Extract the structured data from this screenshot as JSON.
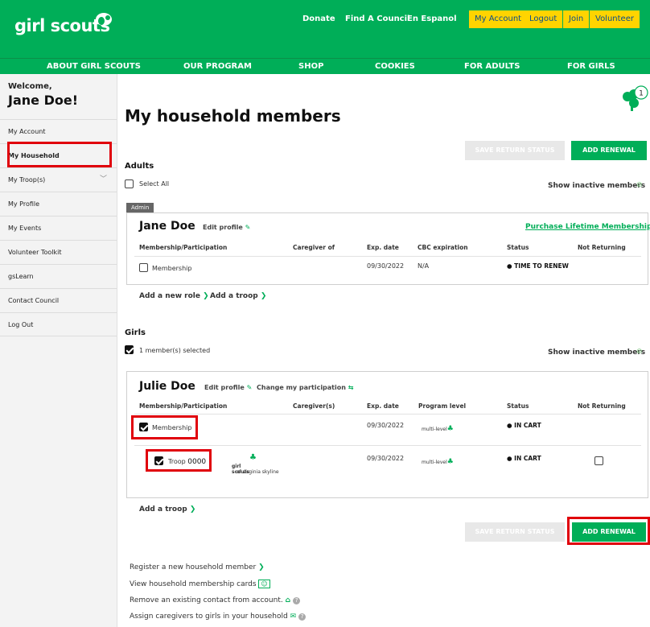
{
  "header": {
    "logo_text": "girl scouts",
    "top_links": [
      "Donate",
      "Find A Council",
      "En Espanol"
    ],
    "account_buttons": [
      "My Account",
      "Logout",
      "Join",
      "Volunteer"
    ],
    "nav": [
      "ABOUT GIRL SCOUTS",
      "OUR PROGRAM",
      "SHOP",
      "COOKIES",
      "FOR ADULTS",
      "FOR GIRLS"
    ],
    "cart_count": "1"
  },
  "sidebar": {
    "welcome": "Welcome,",
    "name": "Jane Doe!",
    "items": [
      {
        "label": "My Account"
      },
      {
        "label": "My Household"
      },
      {
        "label": "My Troop(s)"
      },
      {
        "label": "My Profile"
      },
      {
        "label": "My Events"
      },
      {
        "label": "Volunteer Toolkit"
      },
      {
        "label": "gsLearn"
      },
      {
        "label": "Contact Council"
      },
      {
        "label": "Log Out"
      }
    ]
  },
  "main": {
    "title": "My household members",
    "save_return_status": "SAVE RETURN STATUS",
    "add_renewal": "ADD RENEWAL",
    "adults": {
      "heading": "Adults",
      "select_all": "Select All",
      "show_inactive": "Show inactive members",
      "admin_tag": "Admin",
      "member_name": "Jane Doe",
      "edit_profile": "Edit profile",
      "lifetime": "Purchase Lifetime Membership",
      "columns": [
        "Membership/Participation",
        "Caregiver of",
        "Exp. date",
        "CBC expiration",
        "Status",
        "Not Returning"
      ],
      "row": {
        "label": "Membership",
        "exp": "09/30/2022",
        "cbc": "N/A",
        "status": "TIME TO RENEW"
      },
      "add_role": "Add a new role",
      "add_troop": "Add a troop"
    },
    "girls": {
      "heading": "Girls",
      "selected": "1 member(s) selected",
      "show_inactive": "Show inactive members",
      "member_name": "Julie Doe",
      "edit_profile": "Edit profile",
      "change_participation": "Change my participation",
      "columns": [
        "Membership/Participation",
        "Caregiver(s)",
        "Exp. date",
        "Program level",
        "Status",
        "Not Returning"
      ],
      "rows": [
        {
          "label": "Membership",
          "exp": "09/30/2022",
          "level": "multi-level",
          "status": "IN CART"
        },
        {
          "label": "Troop",
          "troop_no": "0000",
          "council_line1": "girl scouts",
          "council_line2": "of virginia skyline",
          "exp": "09/30/2022",
          "level": "multi-level",
          "status": "IN CART"
        }
      ],
      "add_troop": "Add a troop"
    },
    "footer_links": [
      "Register a new household member",
      "View household membership cards",
      "Remove an existing contact from account.",
      "Assign caregivers to girls in your household"
    ]
  }
}
